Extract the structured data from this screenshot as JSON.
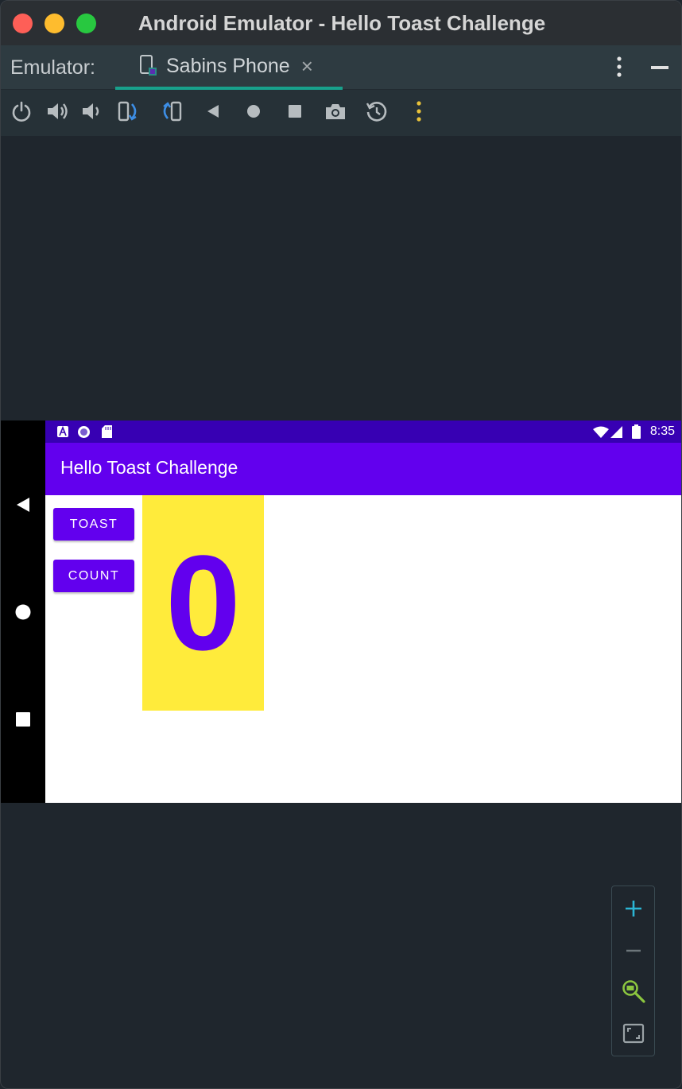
{
  "window": {
    "title": "Android Emulator - Hello Toast Challenge"
  },
  "tabbar": {
    "label": "Emulator:",
    "tab_name": "Sabins Phone",
    "close_glyph": "×"
  },
  "toolbar": {
    "icons": [
      "power-icon",
      "volume-up-icon",
      "volume-down-icon",
      "rotate-left-icon",
      "rotate-right-icon",
      "back-icon",
      "home-icon",
      "overview-icon",
      "screenshot-icon",
      "snapshot-icon",
      "more-icon"
    ]
  },
  "device": {
    "status_time": "8:35",
    "app_title": "Hello Toast Challenge",
    "toast_label": "TOAST",
    "count_label": "COUNT",
    "count_value": "0"
  },
  "colors": {
    "accent": "#6200ee",
    "status_bar": "#3700b3",
    "count_bg": "#ffeb3b",
    "tab_indicator": "#18a18c"
  }
}
